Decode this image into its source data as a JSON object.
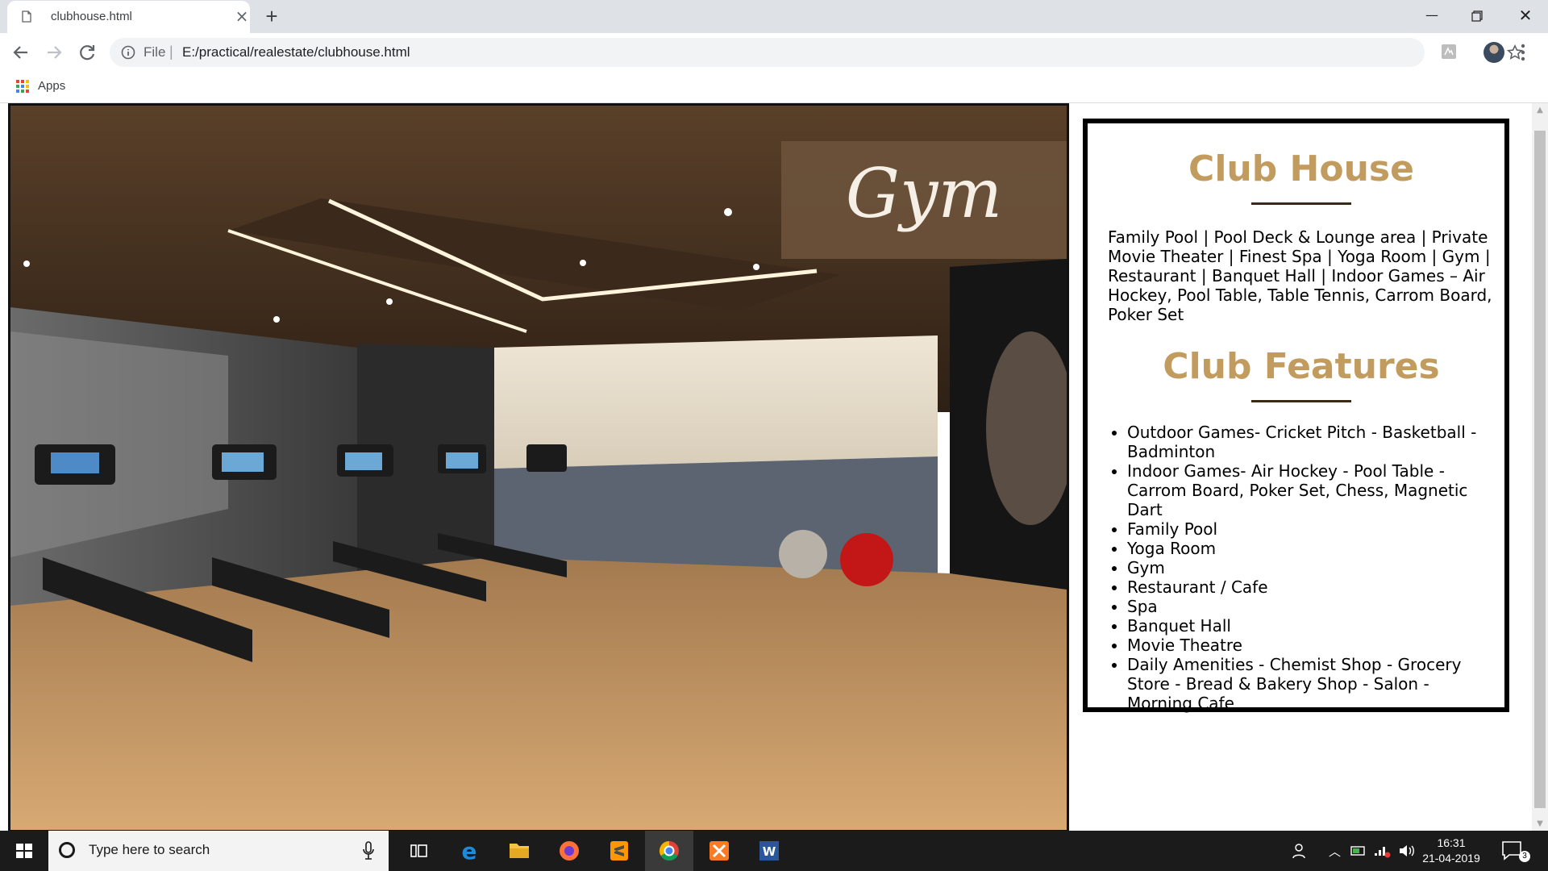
{
  "browser": {
    "tab_title": "clubhouse.html",
    "new_tab_label": "+",
    "url_scheme": "File",
    "url_separator": "|",
    "url": "E:/practical/realestate/clubhouse.html",
    "bookmarks": [
      {
        "label": "Apps",
        "icon": "apps-grid-icon"
      }
    ]
  },
  "page": {
    "image_caption": "Gym",
    "club_house": {
      "title": "Club House",
      "description": "Family Pool | Pool Deck & Lounge area | Private Movie Theater | Finest Spa | Yoga Room | Gym | Restaurant | Banquet Hall | Indoor Games – Air Hockey, Pool Table, Table Tennis, Carrom Board, Poker Set"
    },
    "club_features": {
      "title": "Club Features",
      "items": [
        "Outdoor Games- Cricket Pitch - Basketball - Badminton",
        "Indoor Games- Air Hockey - Pool Table - Carrom Board, Poker Set, Chess, Magnetic Dart",
        "Family Pool",
        "Yoga Room",
        "Gym",
        "Restaurant / Cafe",
        "Spa",
        "Banquet Hall",
        "Movie Theatre",
        "Daily Amenities - Chemist Shop - Grocery Store - Bread & Bakery Shop - Salon - Morning Cafe"
      ]
    },
    "colors": {
      "heading": "#c29b5f",
      "rule": "#3a2a12",
      "banner": "#6c523a"
    }
  },
  "taskbar": {
    "search_placeholder": "Type here to search",
    "apps": [
      "task-view-icon",
      "edge-icon",
      "file-explorer-icon",
      "firefox-icon",
      "sublime-text-icon",
      "chrome-icon",
      "xampp-icon",
      "word-icon"
    ],
    "time": "16:31",
    "date": "21-04-2019",
    "notification_count": "3"
  }
}
